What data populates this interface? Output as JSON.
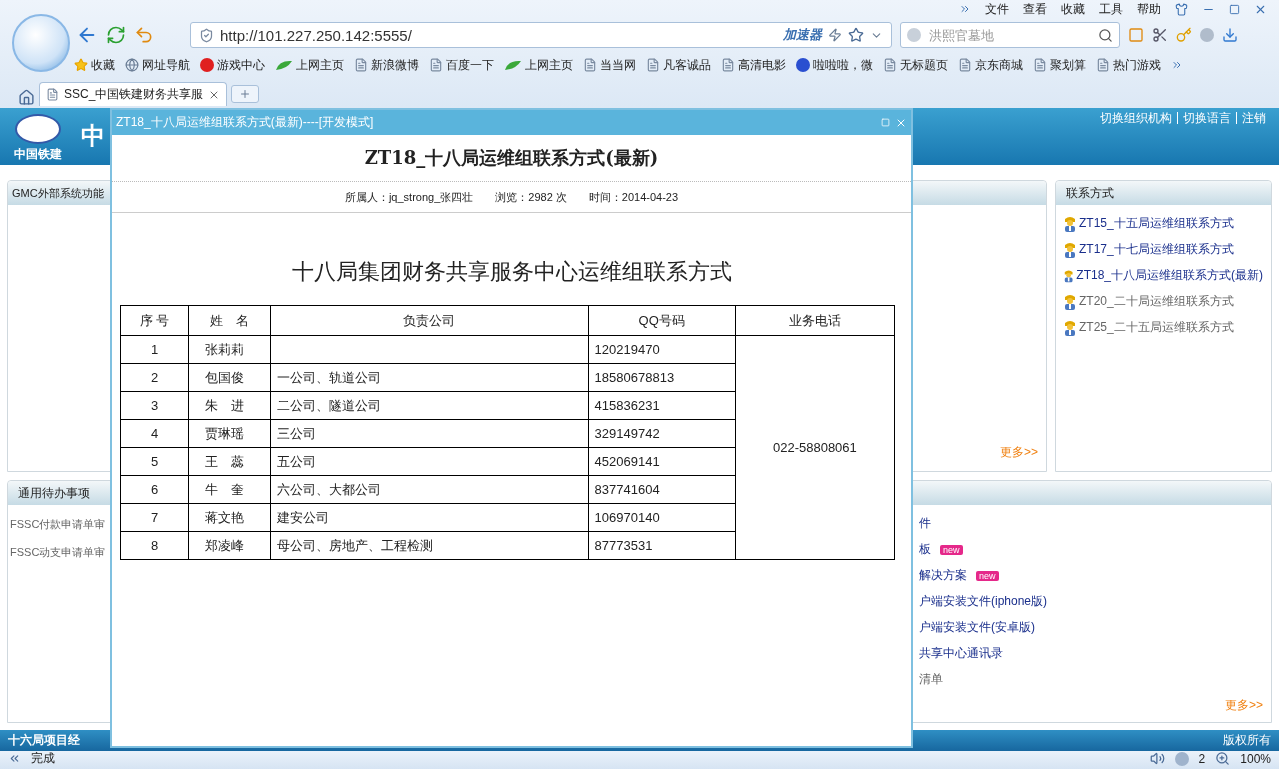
{
  "browser": {
    "menu": [
      "文件",
      "查看",
      "收藏",
      "工具",
      "帮助"
    ],
    "address": "http://101.227.250.142:5555/",
    "accelerator": "加速器",
    "search": {
      "placeholder": "洪熙官墓地"
    },
    "bookmarks": [
      {
        "kind": "star",
        "label": "收藏"
      },
      {
        "kind": "globe",
        "label": "网址导航"
      },
      {
        "kind": "game",
        "label": "游戏中心"
      },
      {
        "kind": "hao",
        "label": "上网主页"
      },
      {
        "kind": "page",
        "label": "新浪微博"
      },
      {
        "kind": "page",
        "label": "百度一下"
      },
      {
        "kind": "hao",
        "label": "上网主页"
      },
      {
        "kind": "page",
        "label": "当当网"
      },
      {
        "kind": "page",
        "label": "凡客诚品"
      },
      {
        "kind": "page",
        "label": "高清电影"
      },
      {
        "kind": "paw",
        "label": "啦啦啦，微"
      },
      {
        "kind": "page",
        "label": "无标题页"
      },
      {
        "kind": "page",
        "label": "京东商城"
      },
      {
        "kind": "page",
        "label": "聚划算"
      },
      {
        "kind": "page",
        "label": "热门游戏"
      }
    ],
    "tabs": [
      {
        "title": "SSC_中国铁建财务共享服",
        "selected": true
      }
    ]
  },
  "page": {
    "logo_caption": "中国铁建",
    "title": "中",
    "header_links": [
      "切换组织机构",
      "切换语言",
      "注销"
    ],
    "top_left_panel": {
      "title": "GMC外部系统功能"
    },
    "top_middle_panel": {
      "more": "更多>>"
    },
    "contacts_panel": {
      "title": "联系方式",
      "items": [
        {
          "label": "ZT15_十五局运维组联系方式",
          "muted": false
        },
        {
          "label": "ZT17_十七局运维组联系方式",
          "muted": false
        },
        {
          "label": "ZT18_十八局运维组联系方式(最新)",
          "muted": false
        },
        {
          "label": "ZT20_二十局运维组联系方式",
          "muted": true
        },
        {
          "label": "ZT25_二十五局运维联系方式",
          "muted": true
        }
      ]
    },
    "todo_panel": {
      "title": "通用待办事项",
      "items": [
        "FSSC付款申请单审",
        "FSSC动支申请单审"
      ]
    },
    "docs_panel": {
      "items": [
        {
          "label": "件",
          "muted": false
        },
        {
          "label": "板",
          "muted": false,
          "badge": "new"
        },
        {
          "label": "解决方案",
          "muted": false,
          "badge": "new"
        },
        {
          "label": "户端安装文件(iphone版)",
          "muted": false
        },
        {
          "label": "户端安装文件(安卓版)",
          "muted": false
        },
        {
          "label": "共享中心通讯录",
          "muted": false
        },
        {
          "label": "清单",
          "muted": true
        }
      ],
      "more": "更多>>"
    },
    "footer": {
      "left": "十六局项目经",
      "right": "版权所有"
    }
  },
  "dialog": {
    "window_title": "ZT18_十八局运维组联系方式(最新)----[开发模式]",
    "heading": "ZT18_十八局运维组联系方式(最新)",
    "meta": [
      "所属人：jq_strong_张四壮",
      "浏览：2982 次",
      "时间：2014-04-23"
    ],
    "doc_title": "十八局集团财务共享服务中心运维组联系方式",
    "table": {
      "columns": [
        "序 号",
        "姓　名",
        "负责公司",
        "QQ号码",
        "业务电话"
      ],
      "rows": [
        {
          "no": "1",
          "name": "张莉莉",
          "qq": "120219470"
        },
        {
          "no": "2",
          "name": "包国俊",
          "company": "一公司、轨道公司",
          "qq": "18580678813"
        },
        {
          "no": "3",
          "name": "朱　进",
          "company": "二公司、隧道公司",
          "qq": "415836231"
        },
        {
          "no": "4",
          "name": "贾琳瑶",
          "company": "三公司",
          "qq": "329149742"
        },
        {
          "no": "5",
          "name": "王　蕊",
          "company": "五公司",
          "qq": "452069141"
        },
        {
          "no": "6",
          "name": "牛　奎",
          "company": "六公司、大都公司",
          "qq": "837741604"
        },
        {
          "no": "7",
          "name": "蒋文艳",
          "company": "建安公司",
          "qq": "106970140"
        },
        {
          "no": "8",
          "name": "郑凌峰",
          "company": "母公司、房地产、工程检测",
          "qq": "87773531"
        }
      ],
      "phone": "022-58808061"
    }
  },
  "status_bar": {
    "status": "完成",
    "count": "2",
    "zoom": "100%"
  }
}
